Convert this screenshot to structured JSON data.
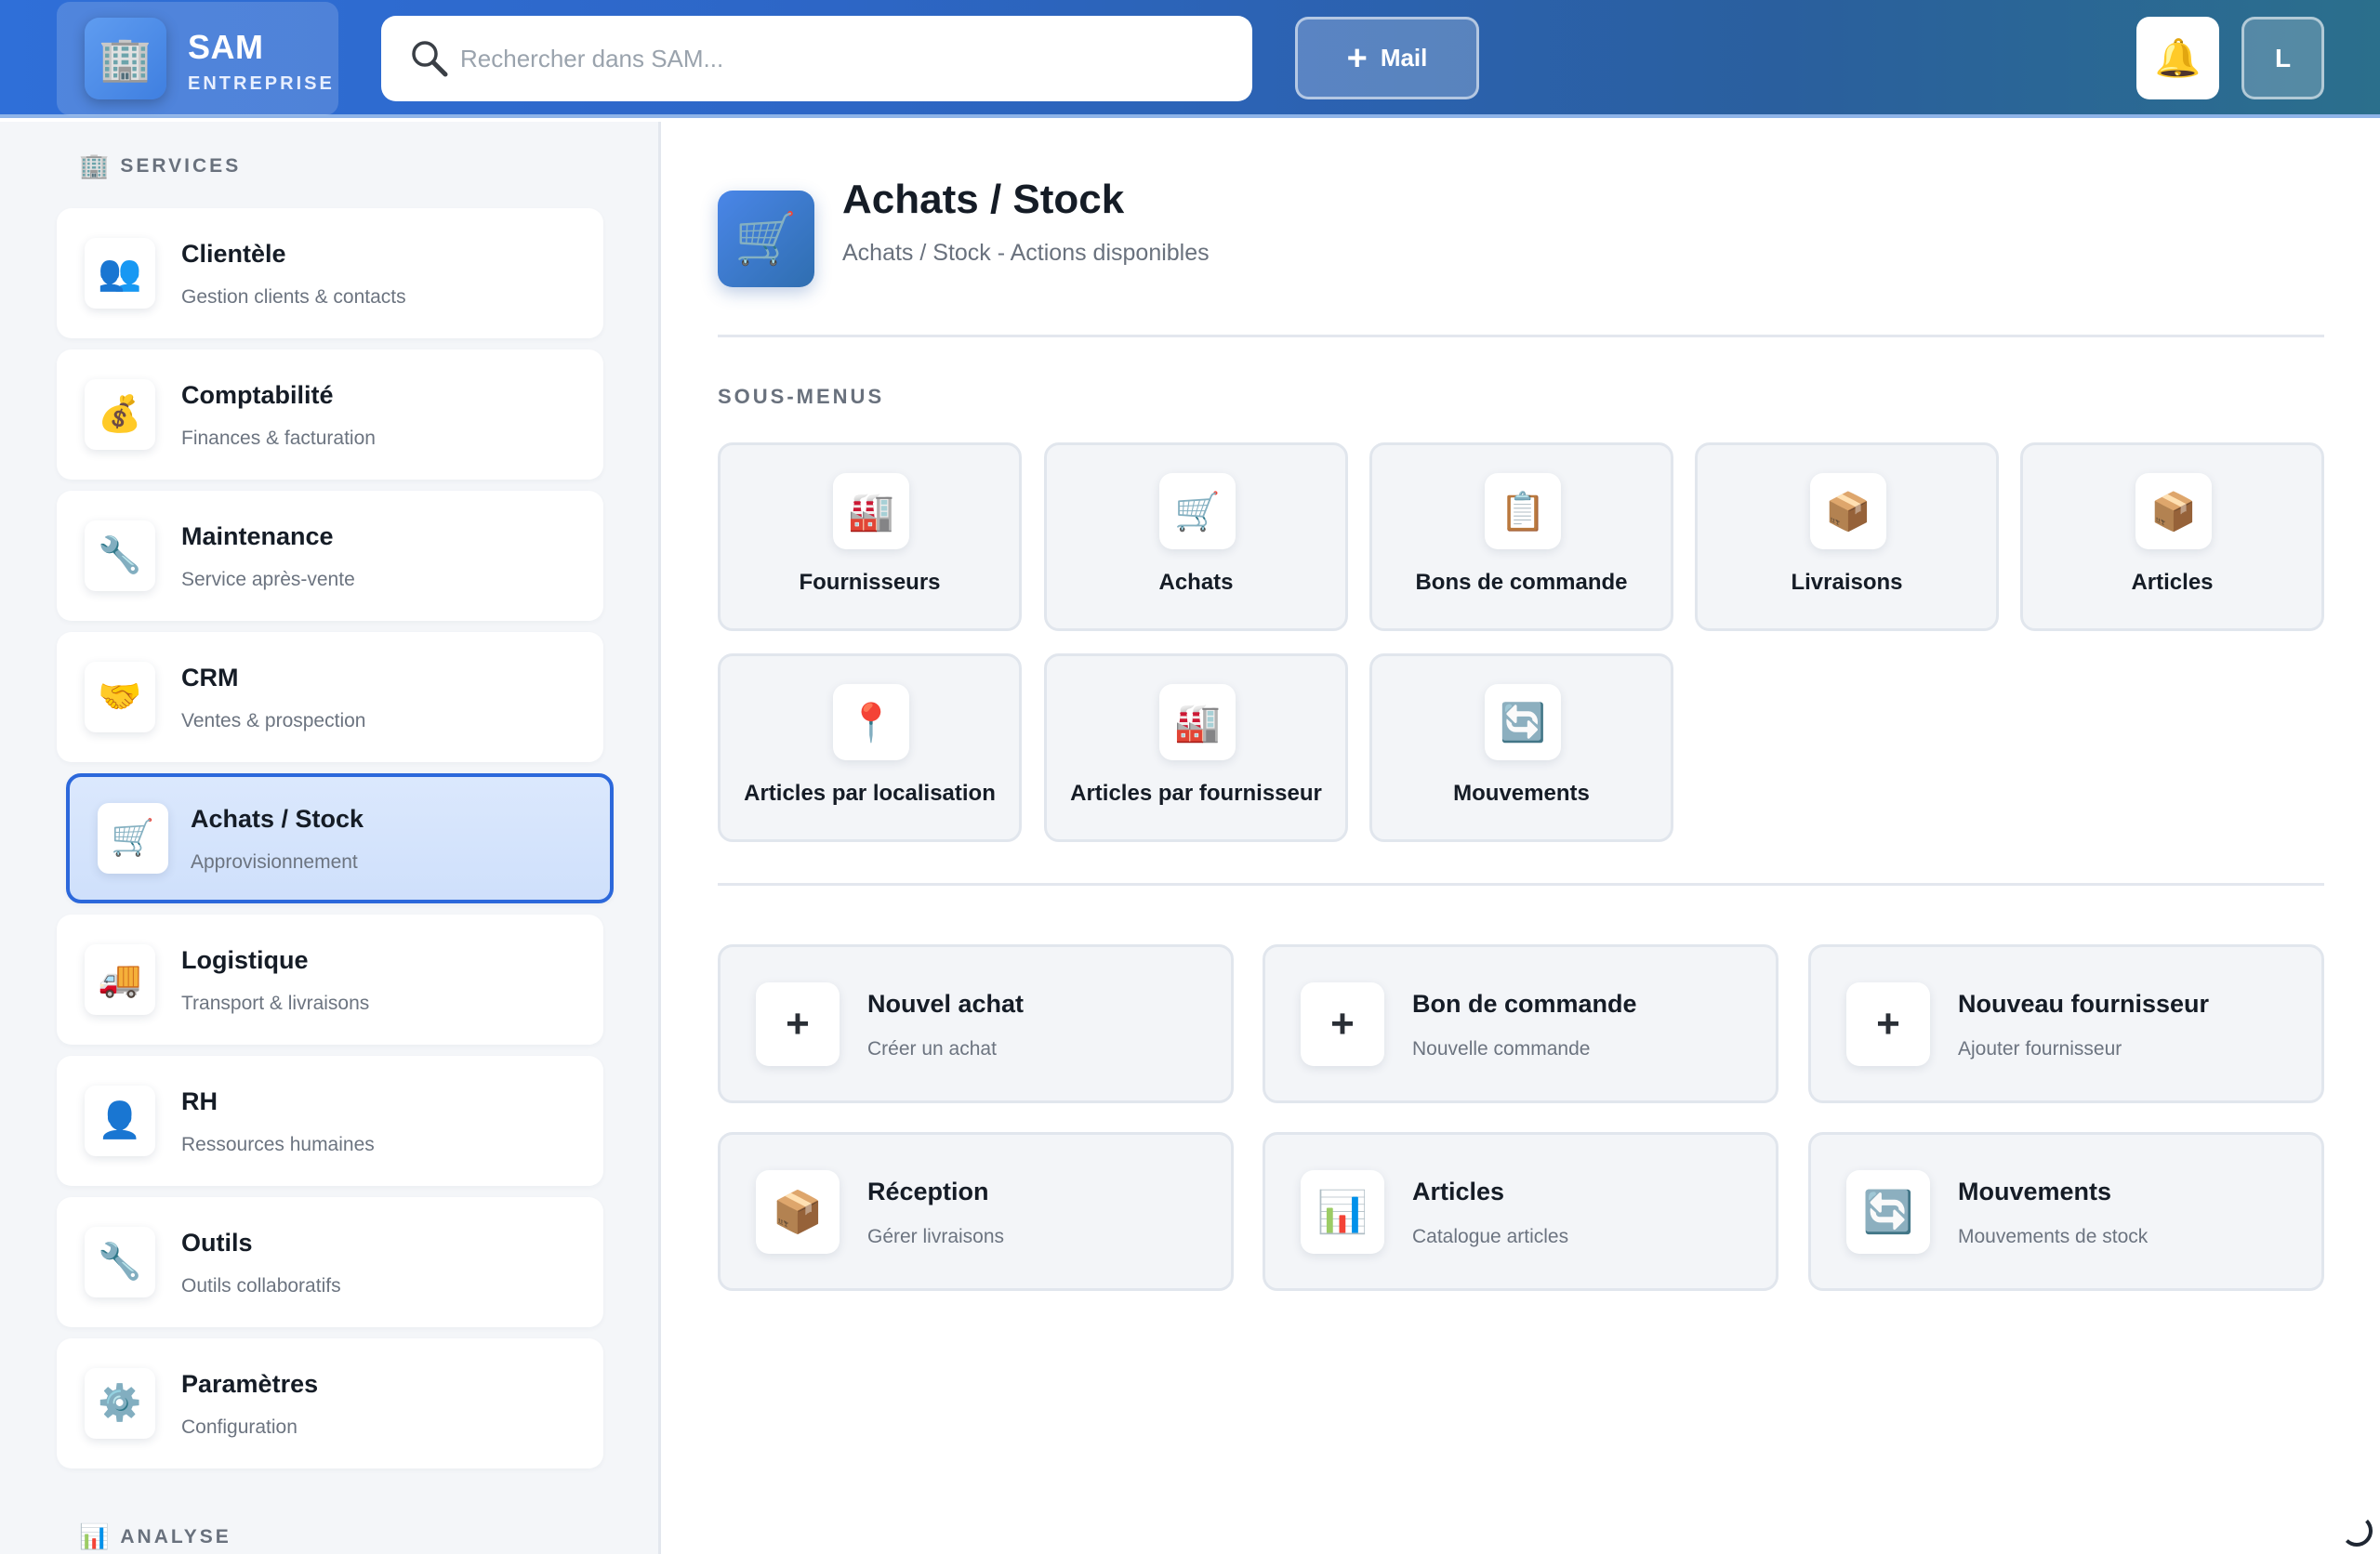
{
  "header": {
    "brand_title": "SAM",
    "brand_subtitle": "ENTREPRISE",
    "brand_icon": "building-icon",
    "search_placeholder": "Rechercher dans SAM...",
    "mail_label": "Mail",
    "avatar_initial": "L"
  },
  "sidebar": {
    "section_services": "SERVICES",
    "section_analyse": "ANALYSE",
    "items": [
      {
        "title": "Clientèle",
        "subtitle": "Gestion clients & contacts",
        "icon": "👥",
        "icon_name": "users-icon"
      },
      {
        "title": "Comptabilité",
        "subtitle": "Finances & facturation",
        "icon": "💰",
        "icon_name": "money-bag-icon"
      },
      {
        "title": "Maintenance",
        "subtitle": "Service après-vente",
        "icon": "🔧",
        "icon_name": "wrench-icon"
      },
      {
        "title": "CRM",
        "subtitle": "Ventes & prospection",
        "icon": "🤝",
        "icon_name": "handshake-icon"
      },
      {
        "title": "Achats / Stock",
        "subtitle": "Approvisionnement",
        "icon": "🛒",
        "icon_name": "cart-icon",
        "active": true
      },
      {
        "title": "Logistique",
        "subtitle": "Transport & livraisons",
        "icon": "🚚",
        "icon_name": "truck-icon"
      },
      {
        "title": "RH",
        "subtitle": "Ressources humaines",
        "icon": "👤",
        "icon_name": "person-icon"
      },
      {
        "title": "Outils",
        "subtitle": "Outils collaboratifs",
        "icon": "🔧",
        "icon_name": "wrench-icon"
      },
      {
        "title": "Paramètres",
        "subtitle": "Configuration",
        "icon": "⚙️",
        "icon_name": "gear-icon"
      }
    ]
  },
  "main": {
    "title": "Achats / Stock",
    "subtitle": "Achats / Stock - Actions disponibles",
    "submenus_label": "SOUS-MENUS",
    "submenus": [
      {
        "label": "Fournisseurs",
        "icon": "🏭",
        "icon_name": "factory-icon"
      },
      {
        "label": "Achats",
        "icon": "🛒",
        "icon_name": "cart-icon"
      },
      {
        "label": "Bons de commande",
        "icon": "📋",
        "icon_name": "clipboard-icon"
      },
      {
        "label": "Livraisons",
        "icon": "📦",
        "icon_name": "package-icon"
      },
      {
        "label": "Articles",
        "icon": "📦",
        "icon_name": "package-icon"
      },
      {
        "label": "Articles par localisation",
        "icon": "📍",
        "icon_name": "pin-icon"
      },
      {
        "label": "Articles par fournisseur",
        "icon": "🏭",
        "icon_name": "factory-icon"
      },
      {
        "label": "Mouvements",
        "icon": "🔄",
        "icon_name": "refresh-icon"
      }
    ],
    "actions": [
      {
        "title": "Nouvel achat",
        "subtitle": "Créer un achat",
        "icon": "+",
        "icon_name": "plus-icon"
      },
      {
        "title": "Bon de commande",
        "subtitle": "Nouvelle commande",
        "icon": "+",
        "icon_name": "plus-icon"
      },
      {
        "title": "Nouveau fournisseur",
        "subtitle": "Ajouter fournisseur",
        "icon": "+",
        "icon_name": "plus-icon"
      },
      {
        "title": "Réception",
        "subtitle": "Gérer livraisons",
        "icon": "📦",
        "icon_name": "package-icon"
      },
      {
        "title": "Articles",
        "subtitle": "Catalogue articles",
        "icon": "📊",
        "icon_name": "bar-chart-icon"
      },
      {
        "title": "Mouvements",
        "subtitle": "Mouvements de stock",
        "icon": "🔄",
        "icon_name": "refresh-icon"
      }
    ]
  }
}
